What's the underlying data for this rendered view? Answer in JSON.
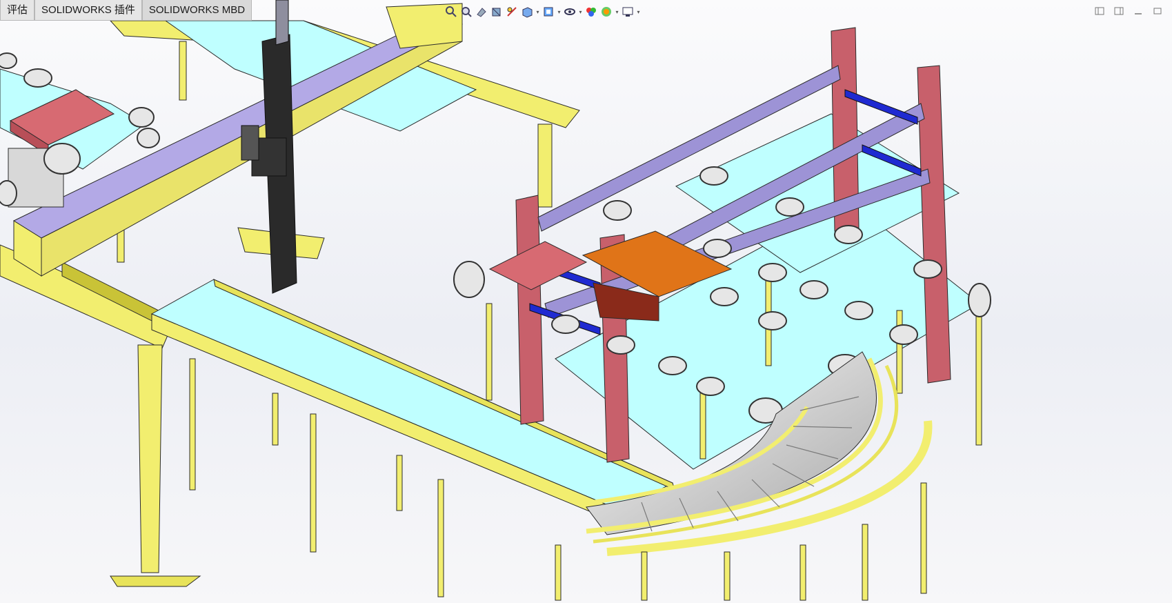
{
  "tabs": [
    {
      "label": "评估"
    },
    {
      "label": "SOLIDWORKS 插件"
    },
    {
      "label": "SOLIDWORKS MBD"
    }
  ],
  "toolbar": {
    "items": [
      "zoom-to-fit-icon",
      "zoom-to-area-icon",
      "previous-view-icon",
      "section-view-icon",
      "dynamic-annotation-icon",
      "view-orientation-icon",
      "display-style-icon",
      "hide-show-items-icon",
      "edit-appearance-icon",
      "apply-scene-icon",
      "view-settings-icon"
    ]
  },
  "window_controls": [
    "tile-left-icon",
    "tile-right-icon",
    "minimize-icon",
    "maximize-icon"
  ],
  "colors": {
    "frame_yellow": "#f2ee6f",
    "frame_yellow_dark": "#c9c337",
    "belt_cyan": "#bfffff",
    "post_red": "#c8606b",
    "rail_lavender": "#9d93d6",
    "bracket_blue": "#1f2ad1",
    "plate_orange": "#e07418",
    "tray_red": "#d76a72",
    "roller_gray": "#d8d8d8",
    "column_black": "#2a2a2a"
  }
}
